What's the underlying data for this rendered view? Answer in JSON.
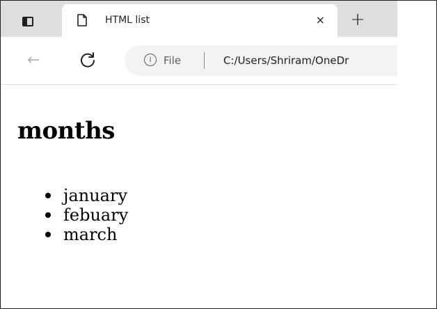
{
  "browser": {
    "tab": {
      "title": "HTML list",
      "close_glyph": "×",
      "page_icon": "document-icon"
    },
    "new_tab_glyph": "+",
    "tab_actions_icon": "tab-actions-icon",
    "toolbar": {
      "back_glyph": "←",
      "reload_icon": "reload-icon"
    },
    "address": {
      "info_glyph": "i",
      "scheme_label": "File",
      "url": "C:/Users/Shriram/OneDr"
    }
  },
  "page": {
    "heading": "months",
    "items": [
      "january",
      "febuary",
      "march"
    ]
  },
  "colors": {
    "tab_strip": "#dedede",
    "tab_active": "#ffffff",
    "address_bar": "#f3f3f3",
    "disabled_icon": "#b5b5b5"
  }
}
